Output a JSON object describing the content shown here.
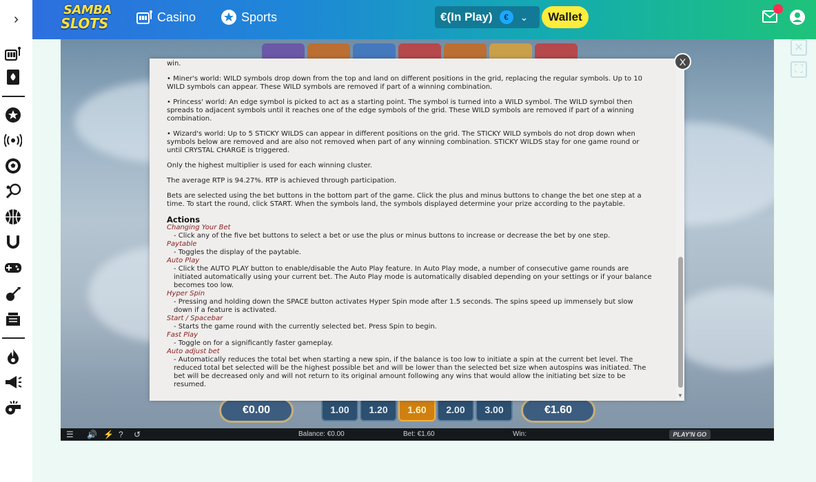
{
  "header": {
    "logo_line1": "SAMBA",
    "logo_line2": "SLOTS",
    "casino_label": "Casino",
    "sports_label": "Sports",
    "balance_label": "€(In Play)",
    "currency_symbol": "€",
    "wallet_label": "Wallet"
  },
  "sidebar": {
    "icons": [
      "casino-icon",
      "cards-icon",
      "sports-star-icon",
      "live-icon",
      "soccer-icon",
      "tennis-icon",
      "basketball-icon",
      "horseshoe-icon",
      "gamepad-icon",
      "darts-icon",
      "tickets-icon",
      "hot-icon",
      "megaphone-icon",
      "whistle-icon"
    ]
  },
  "game": {
    "win_amount": "€0.00",
    "bet_options": [
      "1.00",
      "1.20",
      "1.60",
      "2.00",
      "3.00"
    ],
    "selected_bet": "1.60",
    "bet_amount": "€1.60",
    "status": {
      "balance": "Balance: €0.00",
      "bet": "Bet: €1.60",
      "win": "Win:",
      "brand": "PLAY'N GO"
    }
  },
  "modal": {
    "close_label": "X",
    "partial_top": "win.",
    "rules": [
      "• Miner's world: WILD symbols drop down from the top and land on different positions in the grid, replacing the regular symbols. Up to 10 WILD symbols can appear. These WILD symbols are removed if part of a winning combination.",
      "• Princess' world: An edge symbol is picked to act as a starting point. The symbol is turned into a WILD symbol. The WILD symbol then spreads to adjacent symbols until it reaches one of the edge symbols of the grid. These WILD symbols are removed if part of a winning combination.",
      "• Wizard's world: Up to 5 STICKY WILDS can appear in different positions on the grid. The STICKY WILD symbols do not drop down when symbols below are removed and are also not removed when part of any winning combination. STICKY WILDS stay for one game round or until CRYSTAL CHARGE is triggered.",
      "Only the highest multiplier is used for each winning cluster.",
      "The average RTP is 94.27%. RTP is achieved through participation.",
      "Bets are selected using the bet buttons in the bottom part of the game. Click the plus and minus buttons to change the bet one step at a time. To start the round, click START. When the symbols land, the symbols displayed determine your prize according to the paytable."
    ],
    "actions_heading": "Actions",
    "actions": [
      {
        "title": "Changing Your Bet",
        "desc": "- Click any of the five bet buttons to select a bet or use the plus or minus buttons to increase or decrease the bet by one step."
      },
      {
        "title": "Paytable",
        "desc": "- Toggles the display of the paytable."
      },
      {
        "title": "Auto Play",
        "desc": "- Click the AUTO PLAY button to enable/disable the Auto Play feature. In Auto Play mode, a number of consecutive game rounds are initiated automatically using your current bet. The Auto Play mode is automatically disabled depending on your settings or if your balance becomes too low."
      },
      {
        "title": "Hyper Spin",
        "desc": "- Pressing and holding down the SPACE button activates Hyper Spin mode after 1.5 seconds. The spins speed up immensely but slow down if a feature is activated."
      },
      {
        "title": "Start / Spacebar",
        "desc": "- Starts the game round with the currently selected bet. Press Spin to begin."
      },
      {
        "title": "Fast Play",
        "desc": "- Toggle on for a significantly faster gameplay."
      },
      {
        "title": "Auto adjust bet",
        "desc": "- Automatically reduces the total bet when starting a new spin, if the balance is too low to initiate a spin at the current bet level. The reduced total bet selected will be the highest possible bet and will be lower than the selected bet size when autospins was initiated. The bet will be decreased only and will not return to its original amount following any wins that would allow the initiating bet size to be resumed."
      }
    ]
  },
  "colors": {
    "wallet": "#ffec3b",
    "notification": "#ff2d55",
    "action_title": "#8a1d1d",
    "selected_bet": "#d08010"
  }
}
